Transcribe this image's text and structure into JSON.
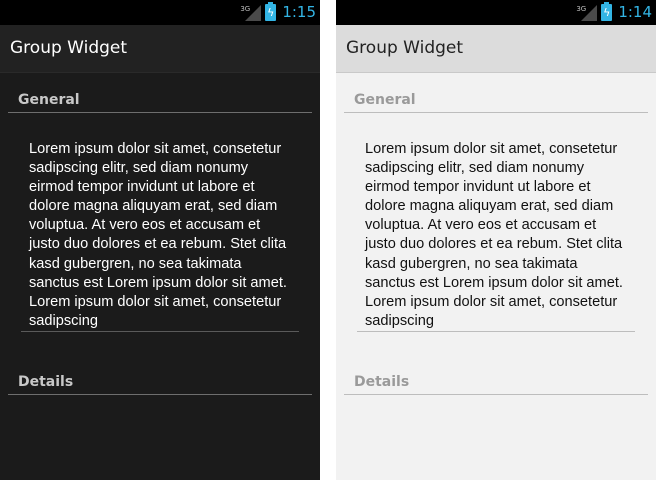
{
  "screens": [
    {
      "theme": "dark",
      "status_bar": {
        "network": "3G",
        "time": "1:15"
      },
      "action_bar": {
        "title": "Group Widget"
      },
      "sections": [
        {
          "header": "General"
        },
        {
          "header": "Details"
        }
      ],
      "text_field": {
        "value": "Lorem ipsum dolor sit amet, consetetur sadipscing elitr, sed diam nonumy eirmod tempor invidunt ut labore et dolore magna aliquyam erat, sed diam voluptua. At vero eos et accusam et justo duo dolores et ea rebum. Stet clita kasd gubergren, no sea takimata sanctus est Lorem ipsum dolor sit amet. Lorem ipsum dolor sit amet, consetetur sadipscing"
      }
    },
    {
      "theme": "light",
      "status_bar": {
        "network": "3G",
        "time": "1:14"
      },
      "action_bar": {
        "title": "Group Widget"
      },
      "sections": [
        {
          "header": "General"
        },
        {
          "header": "Details"
        }
      ],
      "text_field": {
        "value": "Lorem ipsum dolor sit amet, consetetur sadipscing elitr, sed diam nonumy eirmod tempor invidunt ut labore et dolore magna aliquyam erat, sed diam voluptua. At vero eos et accusam et justo duo dolores et ea rebum. Stet clita kasd gubergren, no sea takimata sanctus est Lorem ipsum dolor sit amet. Lorem ipsum dolor sit amet, consetetur sadipscing"
      }
    }
  ],
  "colors": {
    "dark_background": "#1b1b1b",
    "light_background": "#f2f2f2",
    "holo_blue": "#33b5e5",
    "status_bar": "#000000"
  }
}
